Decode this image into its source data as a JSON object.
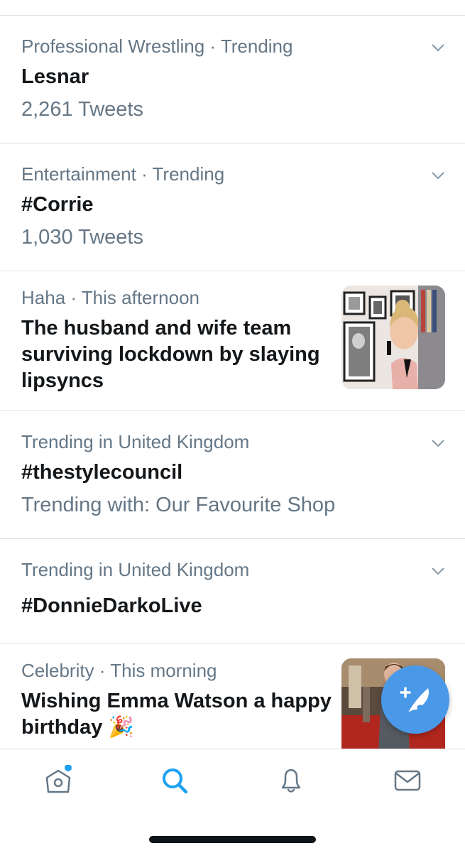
{
  "trends": [
    {
      "meta": "Professional Wrestling · Trending",
      "title": "Lesnar",
      "sub": "2,261 Tweets"
    },
    {
      "meta": "Entertainment · Trending",
      "title": "#Corrie",
      "sub": "1,030 Tweets"
    }
  ],
  "story1": {
    "meta": "Haha · This afternoon",
    "title": "The husband and wife team surviving lockdown by slaying lipsyncs"
  },
  "trends2": [
    {
      "meta": "Trending in United Kingdom",
      "title": "#thestylecouncil",
      "sub": "Trending with: Our Favourite Shop"
    },
    {
      "meta": "Trending in United Kingdom",
      "title": "#DonnieDarkoLive"
    }
  ],
  "story2": {
    "meta": "Celebrity · This morning",
    "title": "Wishing Emma Watson a happy birthday",
    "emoji": "🎉"
  },
  "tabs": [
    "home-icon",
    "search-icon",
    "bell-icon",
    "mail-icon"
  ],
  "colors": {
    "accent": "#1da1f2",
    "fab": "#4a99e9",
    "muted": "#657786"
  }
}
